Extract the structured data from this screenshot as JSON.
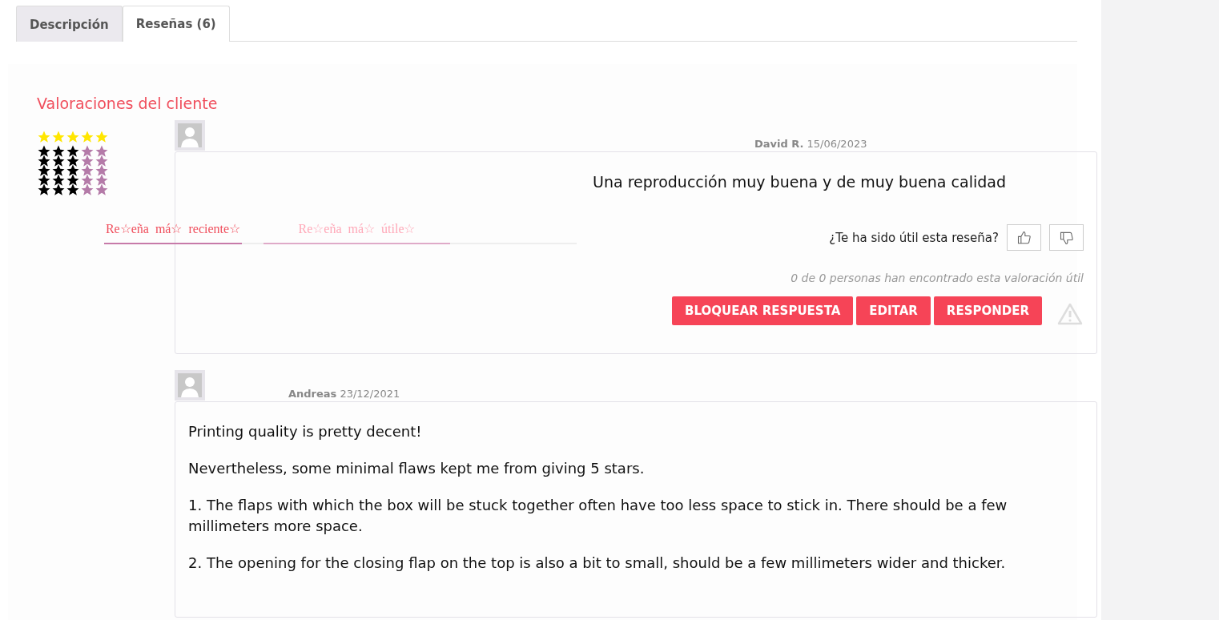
{
  "tabs": [
    {
      "label": "Descripción",
      "selected": false
    },
    {
      "label": "Reseñas (6)",
      "selected": true
    }
  ],
  "summary": {
    "title": "Valoraciones del cliente",
    "average": {
      "stars": 5
    },
    "breakdown": [
      {
        "stars": 3
      },
      {
        "stars": 3
      },
      {
        "stars": 3
      },
      {
        "stars": 3
      },
      {
        "stars": 3
      }
    ]
  },
  "sort_tabs": [
    {
      "label": "Re☆eña  má☆  reciente☆",
      "selected": true
    },
    {
      "label": "Re☆eña  má☆  útile☆",
      "selected": false
    }
  ],
  "reviews": [
    {
      "author": "David R.",
      "date": "15/06/2023",
      "lines": [
        "Una reproducción muy buena y de muy buena calidad"
      ],
      "centered": true,
      "helpful_question": "¿Te ha sido útil esta reseña?",
      "helpful_count": "0 de 0 personas han encontrado esta valoración útil",
      "actions": [
        "BLOQUEAR RESPUESTA",
        "EDITAR",
        "RESPONDER"
      ]
    },
    {
      "author": "Andreas",
      "date": "23/12/2021",
      "centered": false,
      "lines": [
        "Printing quality is pretty decent!",
        "Nevertheless, some minimal flaws kept me from giving 5 stars.",
        "1. The flaps with which the box will be stuck together often have too less space to stick in. There should be a few millimeters more space.",
        "2. The opening for the closing flap on the top is also a bit to small, should be a few millimeters wider and thicker."
      ]
    }
  ]
}
